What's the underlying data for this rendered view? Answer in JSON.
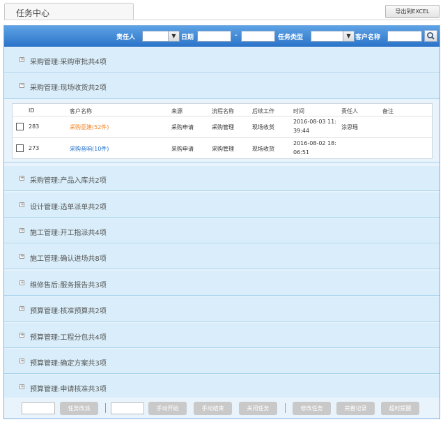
{
  "header": {
    "title": "任务中心",
    "export_label": "导出到EXCEL"
  },
  "filters": {
    "assignee_label": "责任人",
    "date_label": "日期",
    "date_separator": "-",
    "task_type_label": "任务类型",
    "customer_label": "客户名称",
    "assignee_value": "",
    "task_type_value": "",
    "date_from": "",
    "date_to": "",
    "customer_value": ""
  },
  "groups": [
    {
      "label": "采购管理:采购审批共4项",
      "icon": "plus-expand-icon"
    },
    {
      "label": "采购管理:现场收货共2项",
      "icon": "minus-collapse-icon"
    },
    {
      "label": "采购管理:产品入库共2项",
      "icon": "plus-expand-icon"
    },
    {
      "label": "设计管理:选单派单共2项",
      "icon": "plus-expand-icon"
    },
    {
      "label": "施工管理:开工指派共4项",
      "icon": "plus-expand-icon"
    },
    {
      "label": "施工管理:确认进场共8项",
      "icon": "plus-expand-icon"
    },
    {
      "label": "维修售后:服务报告共3项",
      "icon": "plus-expand-icon"
    },
    {
      "label": "预算管理:核准预算共2项",
      "icon": "plus-expand-icon"
    },
    {
      "label": "预算管理:工程分包共4项",
      "icon": "plus-expand-icon"
    },
    {
      "label": "预算管理:确定方案共3项",
      "icon": "plus-expand-icon"
    },
    {
      "label": "预算管理:申请核准共3项",
      "icon": "plus-expand-icon"
    }
  ],
  "table": {
    "columns": [
      "ID",
      "客户名称",
      "来源",
      "流程名称",
      "后续工作",
      "时间",
      "责任人",
      "备注"
    ],
    "rows": [
      {
        "id": "283",
        "customer": "采购亚建(52件)",
        "source": "采购申请",
        "process": "采购管理",
        "next": "现场收货",
        "time_line1": "2016-08-03 11:",
        "time_line2": "39:44",
        "assignee": "涂思瑶",
        "note": ""
      },
      {
        "id": "273",
        "customer": "采购音响(10件)",
        "source": "采购申请",
        "process": "采购管理",
        "next": "现场收货",
        "time_line1": "2016-08-02 18:",
        "time_line2": "06:51",
        "assignee": "",
        "note": ""
      }
    ]
  },
  "bottom": {
    "input1_value": "",
    "input2_value": "",
    "buttons": [
      "任务改派",
      "手动开始",
      "手动结束",
      "关闭任务",
      "修改任务",
      "完善记录",
      "超时提醒"
    ]
  },
  "colors": {
    "filter_bar_top": "#5ea3e6",
    "filter_bar_bottom": "#2b73c8",
    "group_bg": "#d9eefa",
    "orange_link": "#f0801e",
    "blue_link": "#1c6fc8",
    "button_gray": "#c9c9c9"
  }
}
